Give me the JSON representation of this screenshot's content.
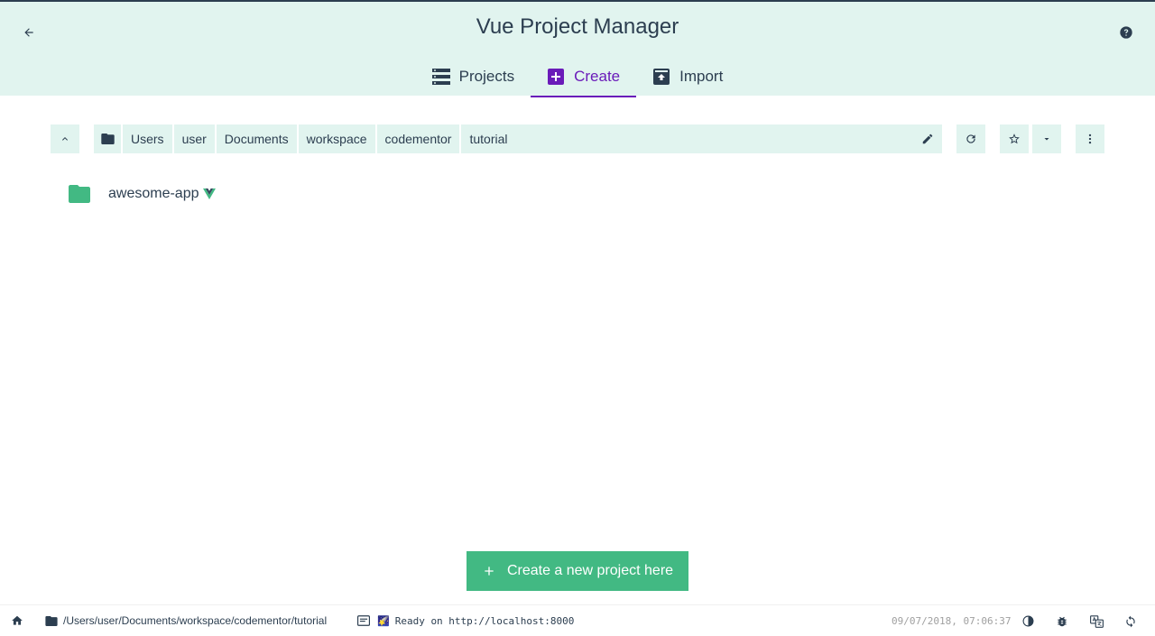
{
  "header": {
    "title": "Vue Project Manager",
    "tabs": [
      {
        "label": "Projects",
        "icon": "list-icon",
        "active": false
      },
      {
        "label": "Create",
        "icon": "add-box-icon",
        "active": true
      },
      {
        "label": "Import",
        "icon": "unarchive-icon",
        "active": false
      }
    ]
  },
  "breadcrumb": {
    "segments": [
      "Users",
      "user",
      "Documents",
      "workspace",
      "codementor",
      "tutorial"
    ]
  },
  "folders": [
    {
      "name": "awesome-app",
      "is_vue_project": true
    }
  ],
  "actions": {
    "create_label": "Create a new project here"
  },
  "statusbar": {
    "cwd": "/Users/user/Documents/workspace/codementor/tutorial",
    "log": "Ready on http://localhost:8000",
    "log_emoji": "🌠",
    "timestamp": "09/07/2018, 07:06:37"
  },
  "colors": {
    "header_bg": "#e1f4ef",
    "accent_purple": "#6a1bb9",
    "brand_green": "#42b983",
    "text_dark": "#2c3e50"
  }
}
